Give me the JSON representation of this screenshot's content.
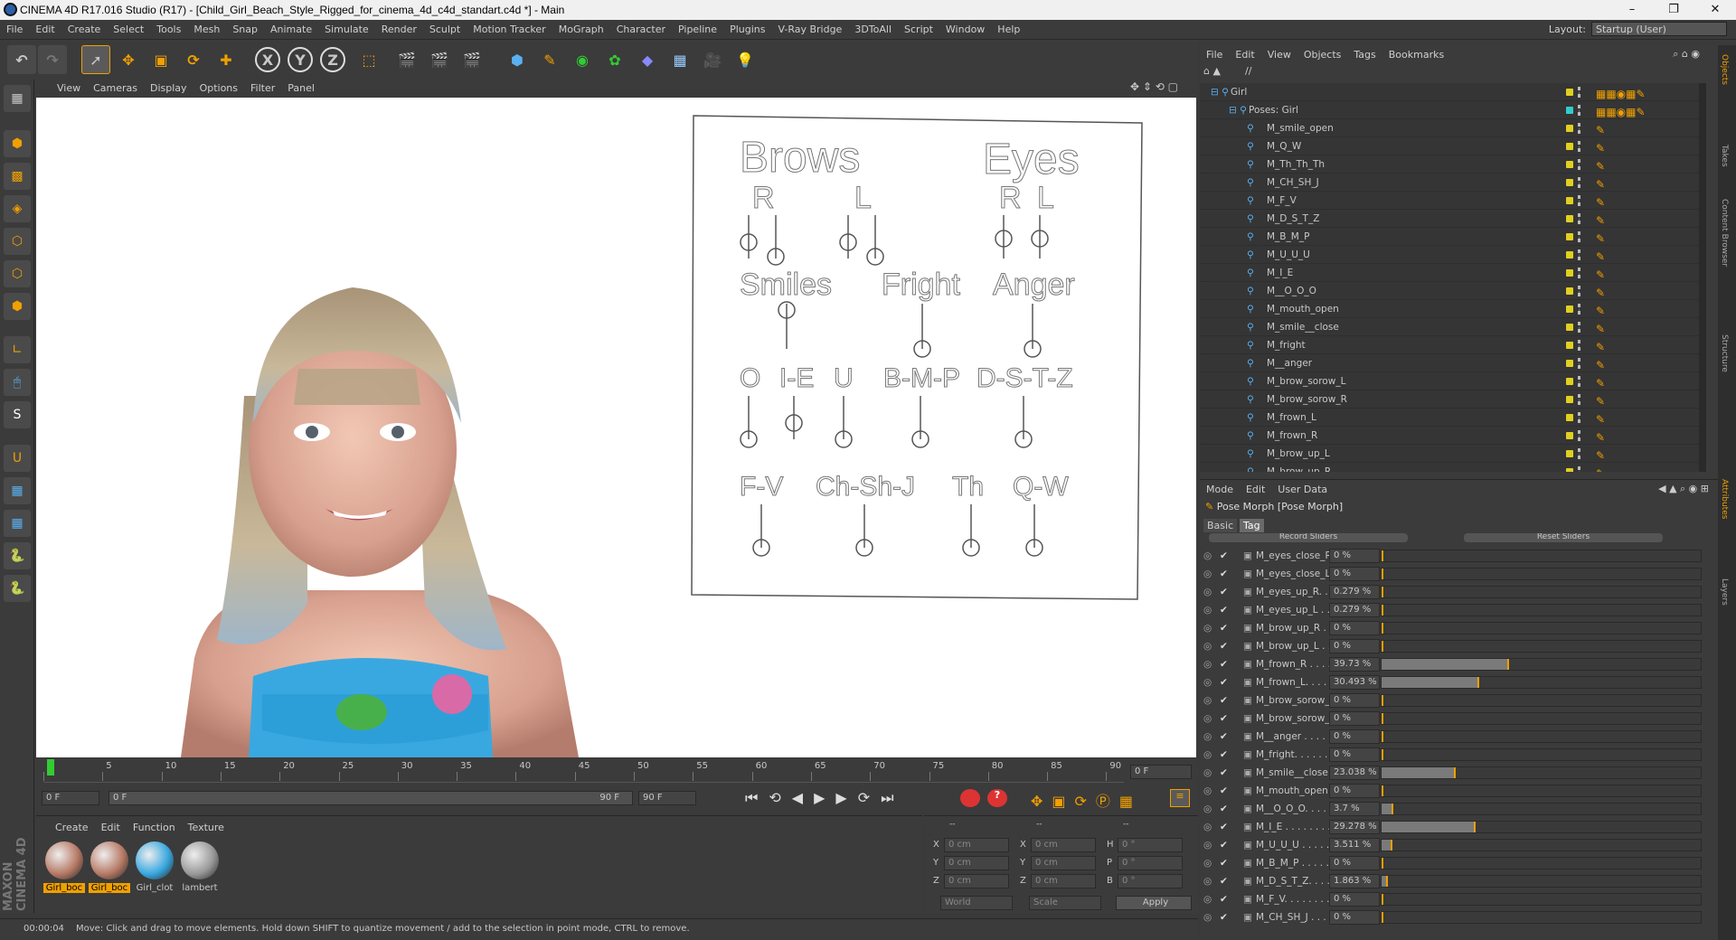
{
  "window": {
    "title": "CINEMA 4D R17.016 Studio (R17) - [Child_Girl_Beach_Style_Rigged_for_cinema_4d_c4d_standart.c4d *] - Main",
    "btn_min": "–",
    "btn_max": "❐",
    "btn_close": "✕"
  },
  "menubar": [
    "File",
    "Edit",
    "Create",
    "Select",
    "Tools",
    "Mesh",
    "Snap",
    "Animate",
    "Simulate",
    "Render",
    "Sculpt",
    "Motion Tracker",
    "MoGraph",
    "Character",
    "Pipeline",
    "Plugins",
    "V-Ray Bridge",
    "3DToAll",
    "Script",
    "Window",
    "Help"
  ],
  "layout": {
    "label": "Layout:",
    "value": "Startup (User)"
  },
  "toolbar": {
    "x": "X",
    "y": "Y",
    "z": "Z"
  },
  "viewport_menu": [
    "View",
    "Cameras",
    "Display",
    "Options",
    "Filter",
    "Panel"
  ],
  "rig": {
    "brows": "Brows",
    "eyes": "Eyes",
    "r1": "R",
    "l1": "L",
    "r2": "R",
    "l2": "L",
    "smiles": "Smiles",
    "fright": "Fright",
    "anger": "Anger",
    "o": "O",
    "ie": "I-E",
    "u": "U",
    "bmp": "B-M-P",
    "dstz": "D-S-T-Z",
    "fv": "F-V",
    "chshj": "Ch-Sh-J",
    "th": "Th",
    "qw": "Q-W"
  },
  "timeline": {
    "ticks": [
      "0",
      "5",
      "10",
      "15",
      "20",
      "25",
      "30",
      "35",
      "40",
      "45",
      "50",
      "55",
      "60",
      "65",
      "70",
      "75",
      "80",
      "85",
      "90"
    ],
    "current_frame": "0 F"
  },
  "transport": {
    "start": "0 F",
    "range_start": "0 F",
    "range_end": "90 F",
    "end": "90 F"
  },
  "materials": {
    "menu": [
      "Create",
      "Edit",
      "Function",
      "Texture"
    ],
    "items": [
      "Girl_boc",
      "Girl_boc",
      "Girl_clot",
      "lambert"
    ]
  },
  "coords": {
    "headers": [
      "--",
      "--",
      "--"
    ],
    "rows": [
      {
        "a": "X",
        "av": "0 cm",
        "b": "X",
        "bv": "0 cm",
        "c": "H",
        "cv": "0 °"
      },
      {
        "a": "Y",
        "av": "0 cm",
        "b": "Y",
        "bv": "0 cm",
        "c": "P",
        "cv": "0 °"
      },
      {
        "a": "Z",
        "av": "0 cm",
        "b": "Z",
        "bv": "0 cm",
        "c": "B",
        "cv": "0 °"
      }
    ],
    "world": "World",
    "scale": "Scale",
    "apply": "Apply"
  },
  "status": {
    "time": "00:00:04",
    "message": "Move: Click and drag to move elements. Hold down SHIFT to quantize movement / add to the selection in point mode, CTRL to remove."
  },
  "object_manager": {
    "menu": [
      "File",
      "Edit",
      "View",
      "Objects",
      "Tags",
      "Bookmarks"
    ],
    "path": "//",
    "root": "Girl",
    "poses": "Poses: Girl",
    "items": [
      "M_smile_open",
      "M_Q_W",
      "M_Th_Th_Th",
      "M_CH_SH_J",
      "M_F_V",
      "M_D_S_T_Z",
      "M_B_M_P",
      "M_U_U_U",
      "M_I_E",
      "M__O_O_O",
      "M_mouth_open",
      "M_smile__close",
      "M_fright",
      "M__anger",
      "M_brow_sorow_L",
      "M_brow_sorow_R",
      "M_frown_L",
      "M_frown_R",
      "M_brow_up_L",
      "M_brow_up_R"
    ]
  },
  "attr_manager": {
    "menu": [
      "Mode",
      "Edit",
      "User Data"
    ],
    "title": "Pose Morph [Pose Morph]",
    "tabs": [
      "Basic",
      "Tag"
    ],
    "record": "Record Sliders",
    "reset": "Reset Sliders",
    "sliders": [
      {
        "name": "M_eyes_close_R . .",
        "value": "0 %",
        "pct": 0
      },
      {
        "name": "M_eyes_close_L . .",
        "value": "0 %",
        "pct": 0
      },
      {
        "name": "M_eyes_up_R. . . .",
        "value": "0.279 %",
        "pct": 0.279
      },
      {
        "name": "M_eyes_up_L . . . .",
        "value": "0.279 %",
        "pct": 0.279
      },
      {
        "name": "M_brow_up_R . . .",
        "value": "0 %",
        "pct": 0
      },
      {
        "name": "M_brow_up_L . . .",
        "value": "0 %",
        "pct": 0
      },
      {
        "name": "M_frown_R . . . . .",
        "value": "39.73 %",
        "pct": 39.73
      },
      {
        "name": "M_frown_L. . . . . .",
        "value": "30.493 %",
        "pct": 30.493
      },
      {
        "name": "M_brow_sorow_R",
        "value": "0 %",
        "pct": 0
      },
      {
        "name": "M_brow_sorow_L",
        "value": "0 %",
        "pct": 0
      },
      {
        "name": "M__anger . . . . . . .",
        "value": "0 %",
        "pct": 0
      },
      {
        "name": "M_fright. . . . . . . .",
        "value": "0 %",
        "pct": 0
      },
      {
        "name": "M_smile__close . .",
        "value": "23.038 %",
        "pct": 23.038
      },
      {
        "name": "M_mouth_open",
        "value": "0 %",
        "pct": 0
      },
      {
        "name": "M__O_O_O. . . . .",
        "value": "3.7 %",
        "pct": 3.7
      },
      {
        "name": "M_I_E . . . . . . . .",
        "value": "29.278 %",
        "pct": 29.278
      },
      {
        "name": "M_U_U_U . . . . . .",
        "value": "3.511 %",
        "pct": 3.511
      },
      {
        "name": "M_B_M_P . . . . . .",
        "value": "0 %",
        "pct": 0
      },
      {
        "name": "M_D_S_T_Z. . . . .",
        "value": "1.863 %",
        "pct": 1.863
      },
      {
        "name": "M_F_V. . . . . . . . .",
        "value": "0 %",
        "pct": 0
      },
      {
        "name": "M_CH_SH_J . . . .",
        "value": "0 %",
        "pct": 0
      }
    ]
  },
  "side_tabs": [
    "Objects",
    "Takes",
    "Content Browser",
    "Structure",
    "Attributes",
    "Layers"
  ],
  "branding": "MAXON CINEMA 4D"
}
